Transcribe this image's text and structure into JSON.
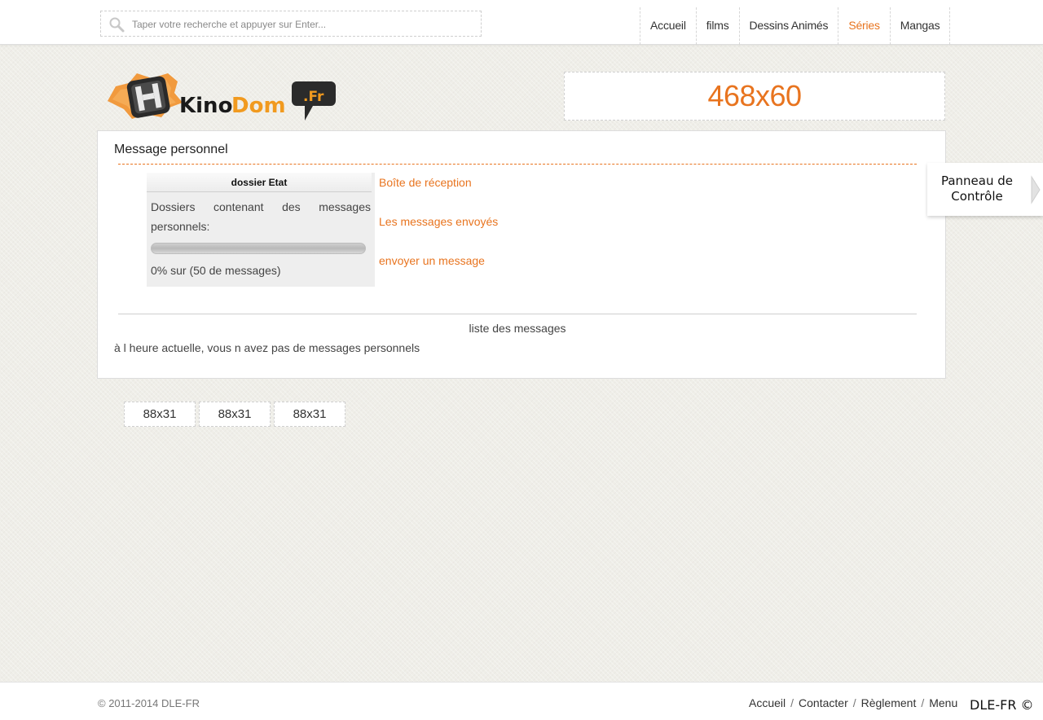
{
  "search": {
    "placeholder": "Taper votre recherche et appuyer sur Enter...",
    "icon": "search-icon"
  },
  "nav": {
    "items": [
      {
        "label": "Accueil",
        "active": false
      },
      {
        "label": "films",
        "active": false
      },
      {
        "label": "Dessins Animés",
        "active": false
      },
      {
        "label": "Séries",
        "active": true
      },
      {
        "label": "Mangas",
        "active": false
      }
    ]
  },
  "logo": {
    "text_main_1": "Kino",
    "text_main_2": "Dom",
    "text_badge": ".Fr"
  },
  "banner": {
    "label": "468x60"
  },
  "colors": {
    "accent": "#e8741f",
    "text": "#333333",
    "background": "#efeee8"
  },
  "message_panel": {
    "title": "Message personnel",
    "status_box": {
      "heading": "dossier Etat",
      "desc_line1_words": [
        "Dossiers",
        "contenant",
        "des",
        "messages"
      ],
      "desc_line2": "personnels:",
      "progress_fraction": 0,
      "count_text": "0% sur (50 de messages)"
    },
    "links": {
      "inbox": "Boîte de réception",
      "sent": "Les messages envoyés",
      "compose": "envoyer un message"
    },
    "list_title": "liste des messages",
    "empty_text": "à l heure actuelle, vous n avez pas de messages personnels"
  },
  "control_panel": {
    "line1": "Panneau de",
    "line2": "Contrôle"
  },
  "small_banners": [
    "88x31",
    "88x31",
    "88x31"
  ],
  "footer": {
    "copyright": "© 2011-2014 DLE-FR",
    "links": [
      "Accueil",
      "Contacter",
      "Règlement",
      "Menu"
    ],
    "separator": "/",
    "badge": "DLE-FR ©"
  }
}
